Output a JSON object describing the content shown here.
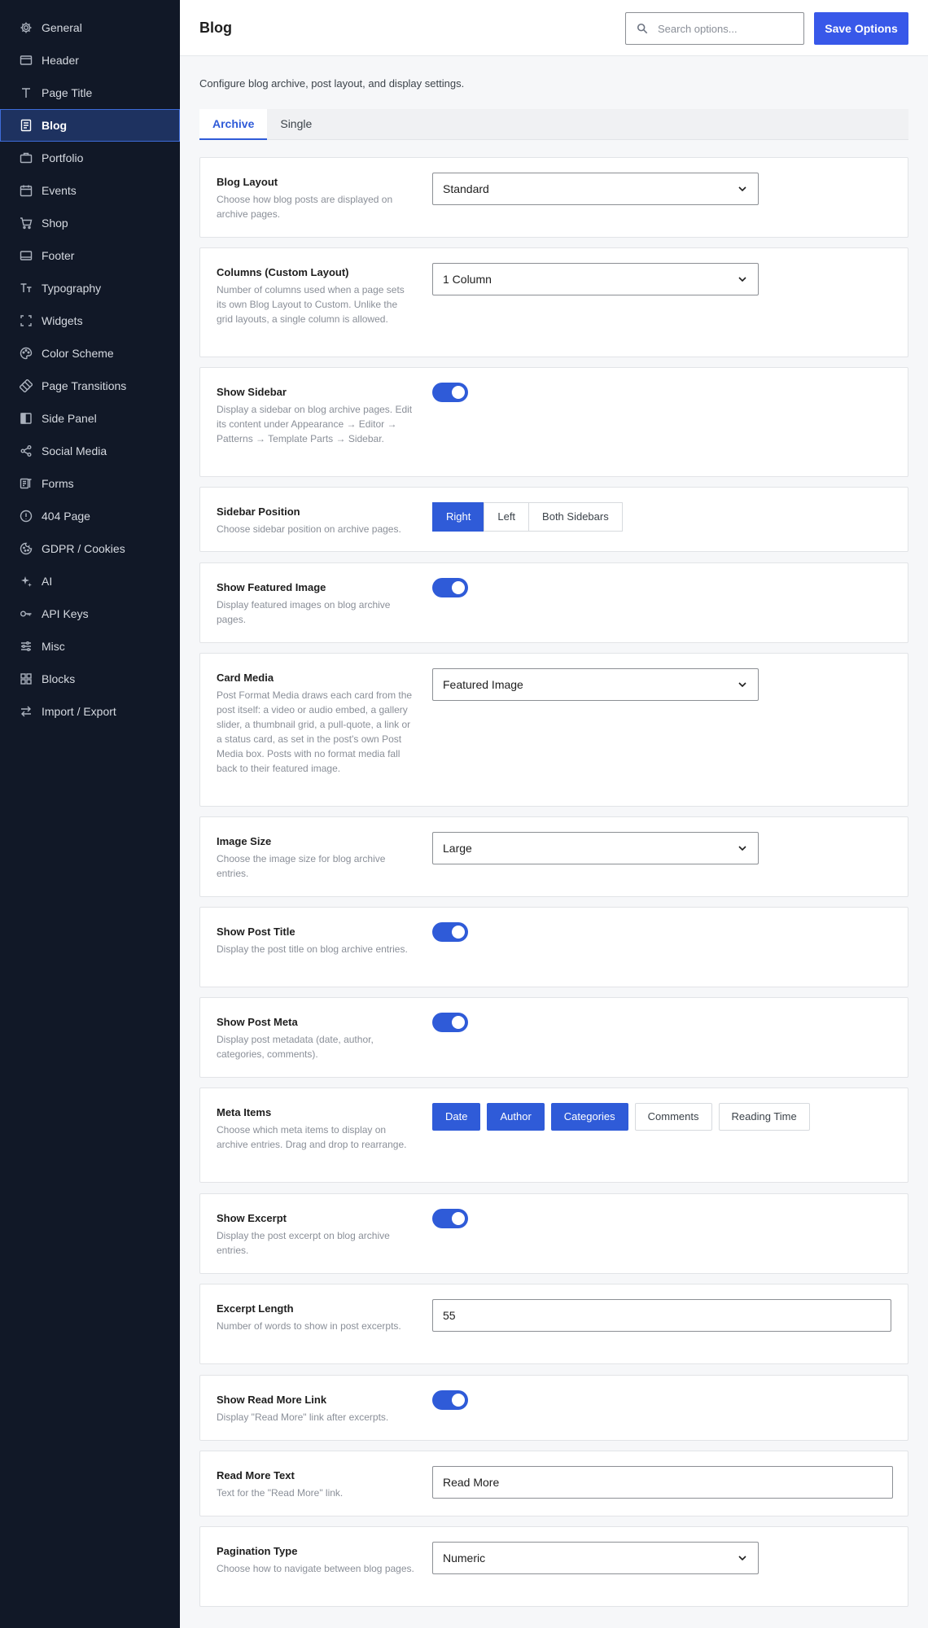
{
  "sidebar": {
    "items": [
      {
        "label": "General",
        "icon": "gear-icon"
      },
      {
        "label": "Header",
        "icon": "header-icon"
      },
      {
        "label": "Page Title",
        "icon": "title-icon"
      },
      {
        "label": "Blog",
        "icon": "blog-icon",
        "active": true
      },
      {
        "label": "Portfolio",
        "icon": "briefcase-icon"
      },
      {
        "label": "Events",
        "icon": "calendar-icon"
      },
      {
        "label": "Shop",
        "icon": "cart-icon"
      },
      {
        "label": "Footer",
        "icon": "footer-icon"
      },
      {
        "label": "Typography",
        "icon": "typography-icon"
      },
      {
        "label": "Widgets",
        "icon": "widgets-icon"
      },
      {
        "label": "Color Scheme",
        "icon": "palette-icon"
      },
      {
        "label": "Page Transitions",
        "icon": "transition-icon"
      },
      {
        "label": "Side Panel",
        "icon": "side-panel-icon"
      },
      {
        "label": "Social Media",
        "icon": "share-icon"
      },
      {
        "label": "Forms",
        "icon": "forms-icon"
      },
      {
        "label": "404 Page",
        "icon": "alert-icon"
      },
      {
        "label": "GDPR / Cookies",
        "icon": "cookie-icon"
      },
      {
        "label": "AI",
        "icon": "sparkle-icon"
      },
      {
        "label": "API Keys",
        "icon": "key-icon"
      },
      {
        "label": "Misc",
        "icon": "sliders-icon"
      },
      {
        "label": "Blocks",
        "icon": "blocks-icon"
      },
      {
        "label": "Import / Export",
        "icon": "import-export-icon"
      }
    ]
  },
  "header": {
    "title": "Blog",
    "search_placeholder": "Search options...",
    "save_label": "Save Options"
  },
  "description": "Configure blog archive, post layout, and display settings.",
  "tabs": [
    {
      "label": "Archive",
      "active": true
    },
    {
      "label": "Single",
      "active": false
    }
  ],
  "options": {
    "blog_layout": {
      "label": "Blog Layout",
      "help": "Choose how blog posts are displayed on archive pages.",
      "value": "Standard"
    },
    "columns": {
      "label": "Columns (Custom Layout)",
      "help": "Number of columns used when a page sets its own Blog Layout to Custom. Unlike the grid layouts, a single column is allowed.",
      "value": "1 Column"
    },
    "show_sidebar": {
      "label": "Show Sidebar",
      "help": "Display a sidebar on blog archive pages. Edit its content under Appearance → Editor → Patterns → Template Parts → Sidebar.",
      "on": true
    },
    "sidebar_position": {
      "label": "Sidebar Position",
      "help": "Choose sidebar position on archive pages.",
      "choices": [
        "Right",
        "Left",
        "Both Sidebars"
      ],
      "selected": "Right"
    },
    "show_featured_image": {
      "label": "Show Featured Image",
      "help": "Display featured images on blog archive pages.",
      "on": true
    },
    "card_media": {
      "label": "Card Media",
      "help": "Post Format Media draws each card from the post itself: a video or audio embed, a gallery slider, a thumbnail grid, a pull-quote, a link or a status card, as set in the post's own Post Media box. Posts with no format media fall back to their featured image.",
      "value": "Featured Image"
    },
    "image_size": {
      "label": "Image Size",
      "help": "Choose the image size for blog archive entries.",
      "value": "Large"
    },
    "show_post_title": {
      "label": "Show Post Title",
      "help": "Display the post title on blog archive entries.",
      "on": true
    },
    "show_post_meta": {
      "label": "Show Post Meta",
      "help": "Display post metadata (date, author, categories, comments).",
      "on": true
    },
    "meta_items": {
      "label": "Meta Items",
      "help": "Choose which meta items to display on archive entries. Drag and drop to rearrange.",
      "items": [
        {
          "label": "Date",
          "active": true
        },
        {
          "label": "Author",
          "active": true
        },
        {
          "label": "Categories",
          "active": true
        },
        {
          "label": "Comments",
          "active": false
        },
        {
          "label": "Reading Time",
          "active": false
        }
      ]
    },
    "show_excerpt": {
      "label": "Show Excerpt",
      "help": "Display the post excerpt on blog archive entries.",
      "on": true
    },
    "excerpt_length": {
      "label": "Excerpt Length",
      "help": "Number of words to show in post excerpts.",
      "value": "55"
    },
    "show_read_more": {
      "label": "Show Read More Link",
      "help": "Display \"Read More\" link after excerpts.",
      "on": true
    },
    "read_more_text": {
      "label": "Read More Text",
      "help": "Text for the \"Read More\" link.",
      "value": "Read More"
    },
    "pagination_type": {
      "label": "Pagination Type",
      "help": "Choose how to navigate between blog pages.",
      "value": "Numeric"
    }
  },
  "colors": {
    "accent": "#2f5bd8",
    "save_button": "#3858e9",
    "sidebar_bg": "#111827",
    "sidebar_active": "#1e3260"
  }
}
